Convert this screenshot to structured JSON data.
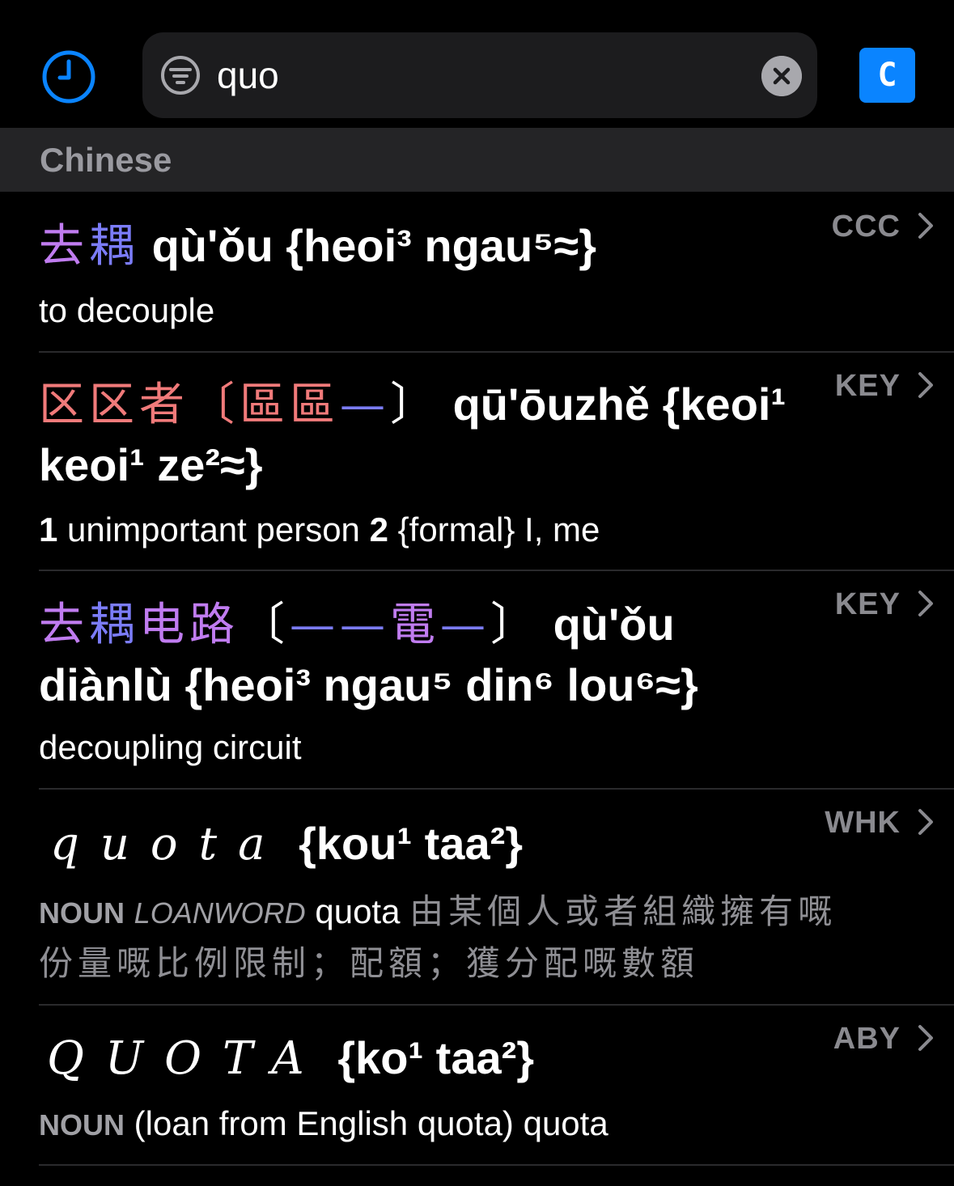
{
  "search": {
    "query": "quo"
  },
  "toolbar": {
    "c_label": "C"
  },
  "section": {
    "title": "Chinese"
  },
  "entries": [
    {
      "source": "CCC",
      "hanzi_a": "去",
      "hanzi_b": "耦",
      "reading": "qù'ǒu {heoi³ ngau⁵≈}",
      "definition": "to decouple"
    },
    {
      "source": "KEY",
      "hanzi": "区区者",
      "trad": "〔區區",
      "trad_b": "—",
      "trad_end": "〕",
      "reading_1": "qū'ōuzhě {keoi¹",
      "reading_2": "keoi¹ ze²≈}",
      "def_n1": "1",
      "def_1": "unimportant person",
      "def_n2": "2",
      "def_2": "{formal} I, me"
    },
    {
      "source": "KEY",
      "hanzi_a": "去",
      "hanzi_b": "耦",
      "hanzi_c": "电路",
      "trad_open": "〔",
      "trad_d1": "—",
      "trad_d2": "—",
      "trad_e": "電",
      "trad_d3": "—",
      "trad_close": "〕",
      "reading_1": "qù'ǒu",
      "reading_2": "diànlù {heoi³ ngau⁵ din⁶ lou⁶≈}",
      "definition": "decoupling circuit"
    },
    {
      "source": "WHK",
      "script": "quota",
      "reading": "{kou¹ taa²}",
      "pos": "NOUN",
      "loan": "LOANWORD",
      "gloss": "quota",
      "chinese_1": "由某個人或者組織擁有嘅",
      "chinese_2": "份量嘅比例限制；配額；獲分配嘅數額"
    },
    {
      "source": "ABY",
      "script": "QUOTA",
      "reading": "{ko¹ taa²}",
      "pos": "NOUN",
      "definition": "(loan from English quota) quota"
    }
  ]
}
